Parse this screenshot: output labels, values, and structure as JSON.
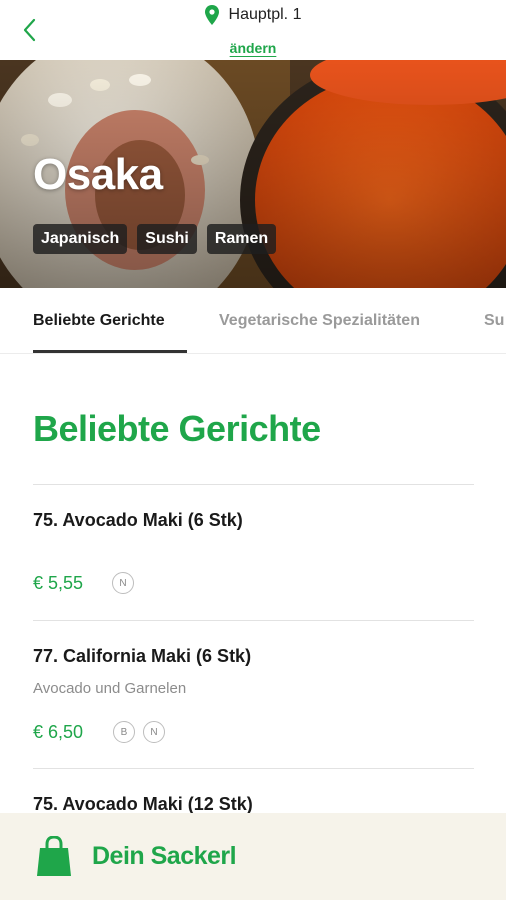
{
  "header": {
    "address": "Hauptpl. 1",
    "change_label": "ändern"
  },
  "restaurant": {
    "name": "Osaka",
    "tags": [
      "Japanisch",
      "Sushi",
      "Ramen"
    ]
  },
  "tabs": [
    {
      "label": "Beliebte Gerichte",
      "active": true
    },
    {
      "label": "Vegetarische Spezialitäten",
      "active": false
    },
    {
      "label": "Su",
      "active": false
    }
  ],
  "section": {
    "title": "Beliebte Gerichte"
  },
  "dishes": [
    {
      "name": "75. Avocado Maki (6 Stk)",
      "description": "",
      "price": "€ 5,55",
      "badges": [
        "N"
      ]
    },
    {
      "name": "77. California Maki (6 Stk)",
      "description": "Avocado und Garnelen",
      "price": "€ 6,50",
      "badges": [
        "B",
        "N"
      ]
    },
    {
      "name": "75. Avocado Maki (12 Stk)",
      "description": "",
      "price": "",
      "badges": []
    }
  ],
  "cart": {
    "label": "Dein Sackerl"
  },
  "colors": {
    "accent": "#1fa64a",
    "cart_bg": "#f6f3ea"
  },
  "icons": {
    "back": "chevron-left-icon",
    "location": "map-pin-icon",
    "cart": "shopping-bag-icon"
  }
}
